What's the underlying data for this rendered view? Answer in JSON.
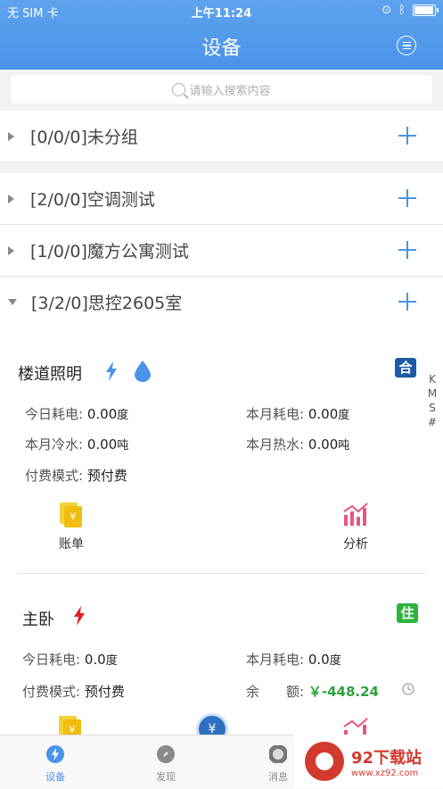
{
  "status_bar": {
    "carrier": "无 SIM 卡",
    "time": "上午11:24"
  },
  "header": {
    "title": "设备"
  },
  "search": {
    "placeholder": "请输入搜索内容"
  },
  "groups": [
    {
      "label": "[0/0/0]未分组",
      "expanded": false
    },
    {
      "label": "[2/0/0]空调测试",
      "expanded": false
    },
    {
      "label": "[1/0/0]魔方公寓测试",
      "expanded": false
    },
    {
      "label": "[3/2/0]思控2605室",
      "expanded": true
    }
  ],
  "index_bar": [
    "K",
    "M",
    "S",
    "#"
  ],
  "devices": [
    {
      "name": "楼道照明",
      "badge": "合",
      "badge_color": "#1f5aa6",
      "today_power_label": "今日耗电:",
      "today_power_value": "0.00",
      "today_power_unit": "度",
      "month_power_label": "本月耗电:",
      "month_power_value": "0.00",
      "month_power_unit": "度",
      "cold_water_label": "本月冷水:",
      "cold_water_value": "0.00",
      "cold_water_unit": "吨",
      "hot_water_label": "本月热水:",
      "hot_water_value": "0.00",
      "hot_water_unit": "吨",
      "pay_mode_label": "付费模式:",
      "pay_mode_value": "预付费",
      "action_bill": "账单",
      "action_analysis": "分析"
    },
    {
      "name": "主卧",
      "badge": "住",
      "badge_color": "#2db43f",
      "today_power_label": "今日耗电:",
      "today_power_value": "0.0",
      "today_power_unit": "度",
      "month_power_label": "本月耗电:",
      "month_power_value": "0.0",
      "month_power_unit": "度",
      "pay_mode_label": "付费模式:",
      "pay_mode_value": "预付费",
      "balance_label": "余　　额:",
      "balance_value": "￥-448.24"
    }
  ],
  "tabs": [
    {
      "label": "设备",
      "icon": "lightning-circle-icon",
      "active": true
    },
    {
      "label": "发现",
      "icon": "compass-icon",
      "active": false
    },
    {
      "label": "消息",
      "icon": "message-icon",
      "active": false
    }
  ],
  "watermark": {
    "text": "92下载站",
    "url": "www.xz92.com"
  },
  "colors": {
    "accent": "#4a93e8",
    "lightning": "#e02020",
    "balance": "#2aa43a"
  }
}
